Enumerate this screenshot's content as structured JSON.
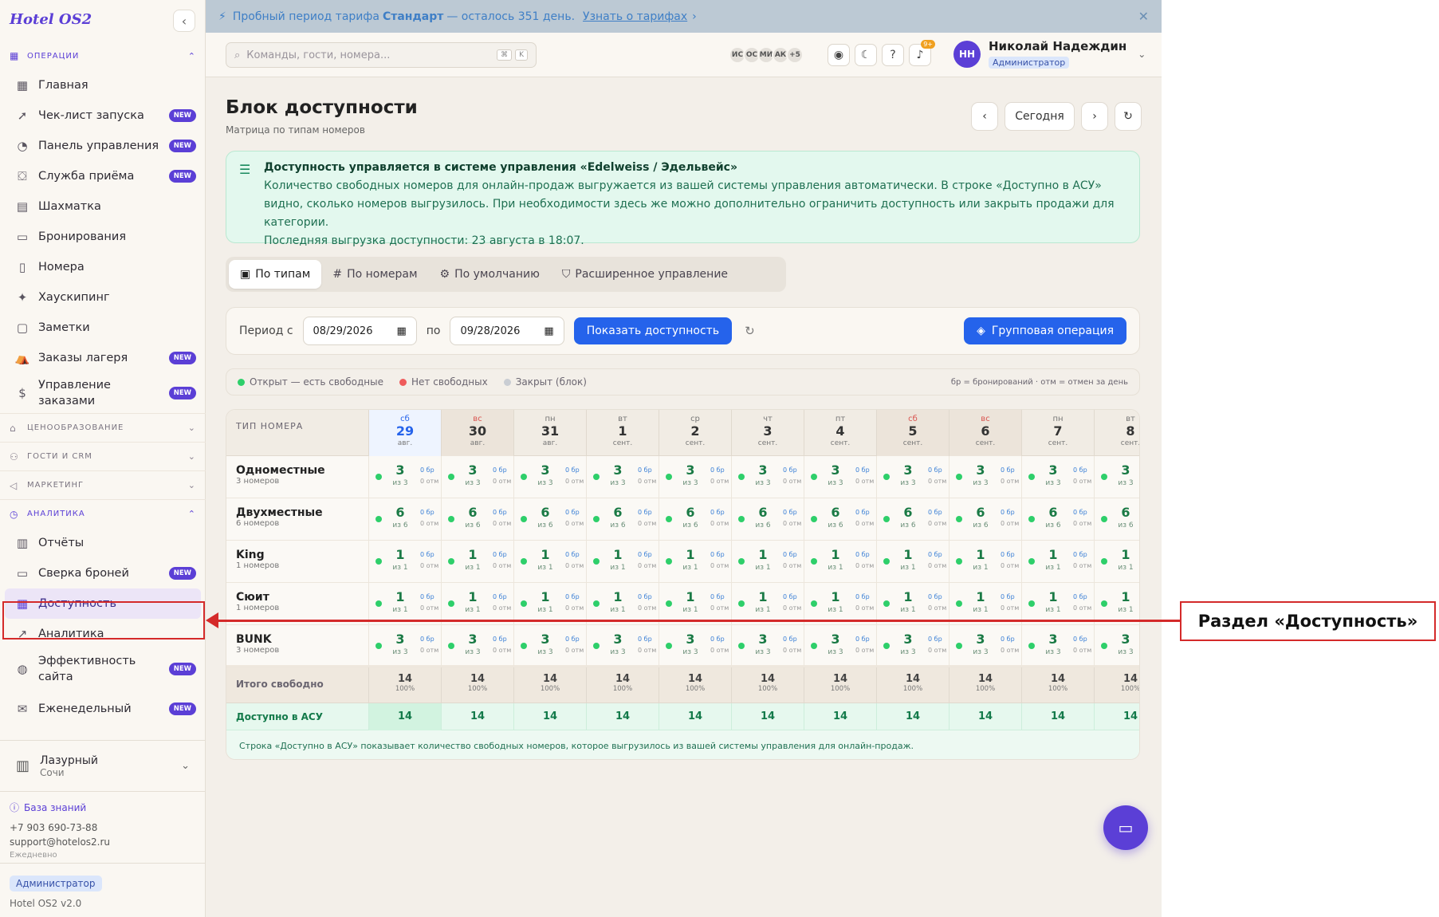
{
  "sidebar": {
    "logo": "Hotel OS2",
    "sections": {
      "operations": "ОПЕРАЦИИ",
      "pricing": "ЦЕНООБРАЗОВАНИЕ",
      "guests": "ГОСТИ И CRM",
      "marketing": "МАРКЕТИНГ",
      "analytics": "АНАЛИТИКА"
    },
    "items": {
      "home": "Главная",
      "launch": "Чек-лист запуска",
      "dashboard": "Панель управления",
      "frontdesk": "Служба приёма",
      "chess": "Шахматка",
      "bookings": "Бронирования",
      "rooms": "Номера",
      "housekeeping": "Хаускипинг",
      "notes": "Заметки",
      "camp": "Заказы лагеря",
      "orders": "Управление заказами",
      "reports": "Отчёты",
      "reconcile": "Сверка броней",
      "availability": "Доступность",
      "analytics": "Аналитика",
      "siteperf": "Эффективность сайта",
      "weekly": "Еженедельный"
    },
    "new_badge": "NEW",
    "hotel": {
      "name": "Лазурный",
      "city": "Сочи"
    },
    "footer": {
      "kb": "База знаний",
      "phone": "+7 903 690-73-88",
      "email": "support@hotelos2.ru",
      "schedule": "Ежедневно"
    },
    "role": "Администратор",
    "version": "Hotel OS2 v2.0"
  },
  "trial": {
    "pre": "Пробный период тарифа",
    "plan": "Стандарт",
    "post": "— осталось 351 день.",
    "link": "Узнать о тарифах"
  },
  "header": {
    "search_placeholder": "Команды, гости, номера...",
    "kbd1": "⌘",
    "kbd2": "K",
    "avatars": [
      "ИС",
      "ОС",
      "МИ",
      "АК",
      "+5"
    ],
    "notif_count": "9+",
    "user_initials": "НН",
    "user_name": "Николай Надеждин",
    "user_role": "Администратор"
  },
  "page": {
    "title": "Блок доступности",
    "subtitle": "Матрица по типам номеров",
    "today_btn": "Сегодня"
  },
  "info": {
    "title": "Доступность управляется в системе управления «Edelweiss / Эдельвейс»",
    "body": "Количество свободных номеров для онлайн-продаж выгружается из вашей системы управления автоматически. В строке «Доступно в АСУ» видно, сколько номеров выгрузилось. При необходимости здесь же можно дополнительно ограничить доступность или закрыть продажи для категории.",
    "last": "Последняя выгрузка доступности: 23 августа в 18:07."
  },
  "tabs": [
    "По типам",
    "По номерам",
    "По умолчанию",
    "Расширенное управление"
  ],
  "filter": {
    "from_label": "Период с",
    "from_value": "08/29/2026",
    "to_label": "по",
    "to_value": "09/28/2026",
    "show_btn": "Показать доступность",
    "group_btn": "Групповая операция"
  },
  "legend": {
    "open": "Открыт — есть свободные",
    "none": "Нет свободных",
    "closed": "Закрыт (блок)",
    "hint": "бр = бронирований · отм = отмен за день"
  },
  "grid": {
    "type_header": "ТИП НОМЕРА",
    "dates": [
      {
        "wd": "сб",
        "d": "29",
        "m": "авг."
      },
      {
        "wd": "вс",
        "d": "30",
        "m": "авг."
      },
      {
        "wd": "пн",
        "d": "31",
        "m": "авг."
      },
      {
        "wd": "вт",
        "d": "1",
        "m": "сент."
      },
      {
        "wd": "ср",
        "d": "2",
        "m": "сент."
      },
      {
        "wd": "чт",
        "d": "3",
        "m": "сент."
      },
      {
        "wd": "пт",
        "d": "4",
        "m": "сент."
      },
      {
        "wd": "сб",
        "d": "5",
        "m": "сент."
      },
      {
        "wd": "вс",
        "d": "6",
        "m": "сент."
      },
      {
        "wd": "пн",
        "d": "7",
        "m": "сент."
      },
      {
        "wd": "вт",
        "d": "8",
        "m": "сент."
      }
    ],
    "rows": [
      {
        "name": "Одноместные",
        "count": "3 номеров",
        "free": "3",
        "of": "из 3"
      },
      {
        "name": "Двухместные",
        "count": "6 номеров",
        "free": "6",
        "of": "из 6"
      },
      {
        "name": "King",
        "count": "1 номеров",
        "free": "1",
        "of": "из 1"
      },
      {
        "name": "Сюит",
        "count": "1 номеров",
        "free": "1",
        "of": "из 1"
      },
      {
        "name": "BUNK",
        "count": "3 номеров",
        "free": "3",
        "of": "из 3"
      }
    ],
    "booked": "0 бр",
    "cancel": "0 отм",
    "total_label": "Итого свободно",
    "total_value": "14",
    "total_pct": "100%",
    "acu_label": "Доступно в АСУ",
    "acu_value": "14",
    "note": "Строка «Доступно в АСУ» показывает количество свободных номеров, которое выгрузилось из вашей системы управления для онлайн-продаж."
  },
  "annotation": {
    "callout": "Раздел «Доступность»"
  },
  "colors": {
    "accent": "#5b3fd6",
    "primary_button": "#2563eb",
    "open": "#2ecf6a",
    "none": "#ef5b5b",
    "closed": "#c9cdd3",
    "annotation": "#d42a2a"
  }
}
